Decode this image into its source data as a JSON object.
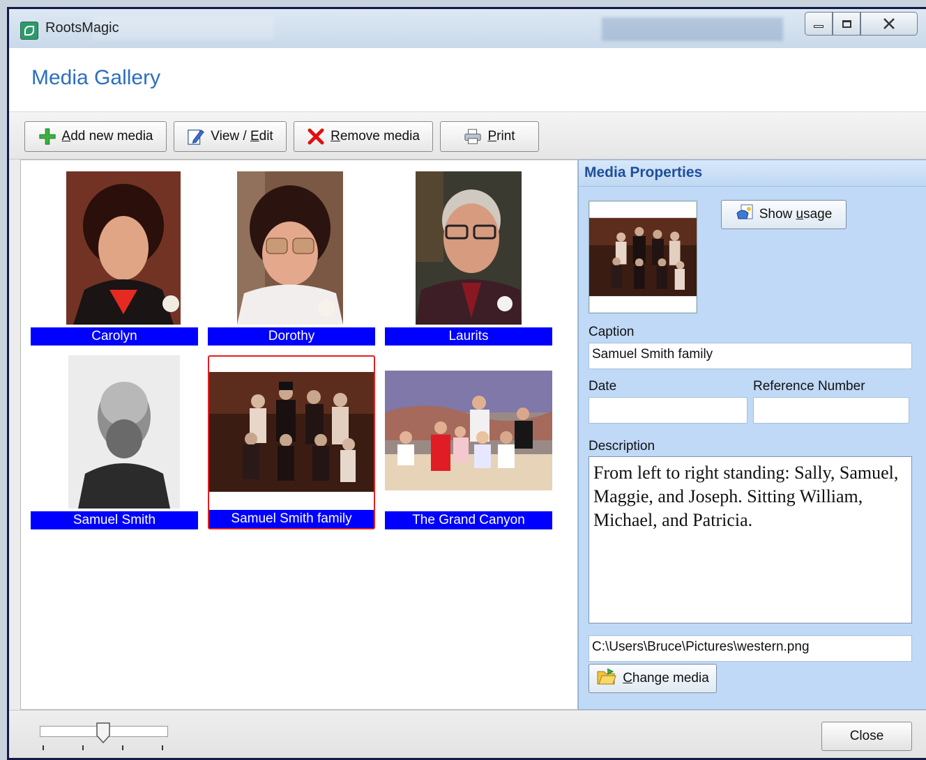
{
  "window": {
    "app_title": "RootsMagic",
    "page_title": "Media Gallery"
  },
  "toolbar": {
    "add_prefix": "",
    "add_u": "A",
    "add_rest": "dd new media",
    "view_prefix": "View / ",
    "view_u": "E",
    "view_rest": "dit",
    "remove_u": "R",
    "remove_rest": "emove media",
    "print_u": "P",
    "print_rest": "rint"
  },
  "gallery": {
    "items": [
      {
        "caption": "Carolyn"
      },
      {
        "caption": "Dorothy"
      },
      {
        "caption": "Laurits"
      },
      {
        "caption": "Samuel Smith"
      },
      {
        "caption": "Samuel Smith family"
      },
      {
        "caption": "The Grand Canyon"
      }
    ],
    "selected_caption": "Samuel Smith family"
  },
  "properties": {
    "title": "Media Properties",
    "show_usage_prefix": "Show ",
    "show_usage_u": "u",
    "show_usage_rest": "sage",
    "caption_label": "Caption",
    "caption_value": "Samuel Smith family",
    "date_label": "Date",
    "date_value": "",
    "refnum_label": "Reference Number",
    "refnum_value": "",
    "description_label": "Description",
    "description_value": "From left to right standing: Sally, Samuel, Maggie, and Joseph.  Sitting William, Michael, and Patricia.",
    "file_path": "C:\\Users\\Bruce\\Pictures\\western.png",
    "change_media_u": "C",
    "change_media_rest": "hange media"
  },
  "footer": {
    "close_label": "Close"
  },
  "colors": {
    "title_blue": "#2c6ebf",
    "caption_bg": "#0000ff",
    "selected_border": "#e02020",
    "props_bg": "#bfd9f6"
  }
}
